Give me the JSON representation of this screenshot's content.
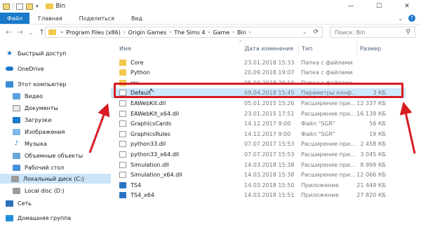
{
  "window": {
    "title": "Bin",
    "minimize_glyph": "—",
    "maximize_glyph": "☐",
    "close_glyph": "✕"
  },
  "ribbon": {
    "tabs": [
      "Файл",
      "Главная",
      "Поделиться",
      "Вид"
    ],
    "expand_glyph": "⌄",
    "help_glyph": "?"
  },
  "nav": {
    "back_glyph": "←",
    "forward_glyph": "→",
    "recent_glyph": "⌄",
    "up_glyph": "↑"
  },
  "address": {
    "prefix": "«",
    "crumbs": [
      "Program Files (x86)",
      "Origin Games",
      "The Sims 4",
      "Game",
      "Bin"
    ],
    "separator": "›",
    "dropdown_glyph": "⌄",
    "refresh_glyph": "⟳"
  },
  "search": {
    "placeholder": "Поиск: Bin",
    "icon_glyph": "⚲"
  },
  "sidebar": {
    "items": [
      {
        "label": "Быстрый доступ",
        "icon": "star-icon"
      },
      {
        "label": "OneDrive",
        "icon": "cloud-icon"
      },
      {
        "label": "Этот компьютер",
        "icon": "computer-icon"
      },
      {
        "label": "Видео",
        "icon": "video-icon"
      },
      {
        "label": "Документы",
        "icon": "documents-icon"
      },
      {
        "label": "Загрузки",
        "icon": "downloads-icon"
      },
      {
        "label": "Изображения",
        "icon": "images-icon"
      },
      {
        "label": "Музыка",
        "icon": "music-icon"
      },
      {
        "label": "Объемные объекты",
        "icon": "3d-objects-icon"
      },
      {
        "label": "Рабочий стол",
        "icon": "desktop-icon"
      },
      {
        "label": "Локальный диск (C:)",
        "icon": "drive-icon"
      },
      {
        "label": "Local disc (D:)",
        "icon": "drive-icon"
      },
      {
        "label": "Сеть",
        "icon": "network-icon"
      },
      {
        "label": "Домашняя группа",
        "icon": "homegroup-icon"
      }
    ],
    "selected_index": 10
  },
  "columns": {
    "name": "Имя",
    "date": "Дата изменения",
    "type": "Тип",
    "size": "Размер",
    "collapse_glyph": "^"
  },
  "files": [
    {
      "name": "Core",
      "date": "23.01.2018 15:33",
      "type": "Папка с файлами",
      "size": "",
      "icon": "folder-icon"
    },
    {
      "name": "Python",
      "date": "20.09.2018 19:07",
      "type": "Папка с файлами",
      "size": "",
      "icon": "folder-icon"
    },
    {
      "name": "res",
      "date": "05.04.2018 20:10",
      "type": "Папка с файлами",
      "size": "",
      "icon": "folder-icon"
    },
    {
      "name": "Default",
      "date": "09.04.2018 15:45",
      "type": "Параметры конф...",
      "size": "3 КБ",
      "icon": "settings-file-icon"
    },
    {
      "name": "EAWebKit.dll",
      "date": "05.01.2015 15:26",
      "type": "Расширение при...",
      "size": "12 337 КБ",
      "icon": "dll-file-icon"
    },
    {
      "name": "EAWebKit_x64.dll",
      "date": "23.01.2015 17:51",
      "type": "Расширение при...",
      "size": "16 139 КБ",
      "icon": "dll-file-icon"
    },
    {
      "name": "GraphicsCards",
      "date": "14.12.2017 9:00",
      "type": "Файл \"SGR\"",
      "size": "56 КБ",
      "icon": "file-icon"
    },
    {
      "name": "GraphicsRules",
      "date": "14.12.2017 9:00",
      "type": "Файл \"SGR\"",
      "size": "19 КБ",
      "icon": "file-icon"
    },
    {
      "name": "python33.dll",
      "date": "07.07.2017 15:53",
      "type": "Расширение при...",
      "size": "2 458 КБ",
      "icon": "dll-file-icon"
    },
    {
      "name": "python33_x64.dll",
      "date": "07.07.2017 15:53",
      "type": "Расширение при...",
      "size": "3 045 КБ",
      "icon": "dll-file-icon"
    },
    {
      "name": "Simulation.dll",
      "date": "14.03.2018 15:38",
      "type": "Расширение при...",
      "size": "8 999 КБ",
      "icon": "dll-file-icon"
    },
    {
      "name": "Simulation_x64.dll",
      "date": "14.03.2018 15:38",
      "type": "Расширение при...",
      "size": "12 066 КБ",
      "icon": "dll-file-icon"
    },
    {
      "name": "TS4",
      "date": "14.03.2018 15:50",
      "type": "Приложение",
      "size": "21 449 КБ",
      "icon": "app-icon"
    },
    {
      "name": "TS4_x64",
      "date": "14.03.2018 15:51",
      "type": "Приложение",
      "size": "27 820 КБ",
      "icon": "app-icon"
    }
  ],
  "highlighted_index": 3,
  "colors": {
    "file_tab": "#1979ca",
    "selected_bg": "#cce8ff",
    "annotation_red": "#d81c22",
    "folder": "#f0c94d"
  }
}
